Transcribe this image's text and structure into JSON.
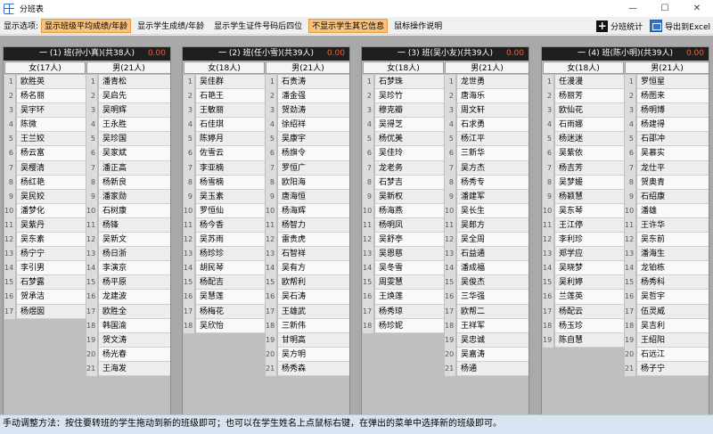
{
  "window": {
    "title": "分班表",
    "min": "—",
    "max": "☐",
    "close": "✕"
  },
  "toolbar": {
    "label": "显示选项:",
    "buttons": [
      {
        "label": "显示班级平均成绩/年龄",
        "active": true
      },
      {
        "label": "显示学生成绩/年龄",
        "active": false
      },
      {
        "label": "显示学生证件号码后四位",
        "active": false
      },
      {
        "label": "不显示学生其它信息",
        "active": true
      },
      {
        "label": "鼠标操作说明",
        "active": false
      }
    ],
    "stats_label": "分班统计",
    "export_label": "导出到Excel"
  },
  "classes": [
    {
      "header": "一 (1) 班(孙小真)(共38人)",
      "score": "0.00",
      "female_header": "女(17人)",
      "male_header": "男(21人)",
      "female": [
        "欧胜英",
        "杨名丽",
        "吴宇环",
        "陈微",
        "王兰姣",
        "杨云富",
        "吴樱清",
        "杨红艳",
        "吴民姣",
        "潘梦化",
        "吴紫丹",
        "吴东素",
        "杨宁宁",
        "李引男",
        "石梦露",
        "贺承洁",
        "杨煜囡"
      ],
      "male": [
        "潘青松",
        "吴启先",
        "吴明辉",
        "王永胜",
        "吴珍国",
        "吴家斌",
        "潘正高",
        "杨新良",
        "潘家勋",
        "石树康",
        "杨锋",
        "吴新文",
        "杨日浙",
        "李演京",
        "杨平原",
        "龙建波",
        "欧胜全",
        "韩国渝",
        "贺文涛",
        "杨光春",
        "王海发"
      ]
    },
    {
      "header": "一 (2) 班(任小雪)(共39人)",
      "score": "0.00",
      "female_header": "女(18人)",
      "male_header": "男(21人)",
      "female": [
        "吴佳群",
        "石艳王",
        "王敏丽",
        "石佳琪",
        "陈婷月",
        "佐雪云",
        "李亚楠",
        "杨雪楠",
        "吴玉素",
        "罗恒仙",
        "杨今香",
        "吴苏雨",
        "杨珍珍",
        "胡民琴",
        "杨配吉",
        "吴慧莲",
        "杨梅花",
        "吴欣怡"
      ],
      "male": [
        "石贵涛",
        "潘金强",
        "贺劲涛",
        "徐绍祥",
        "吴康宇",
        "杨旗令",
        "罗恒广",
        "欧阳海",
        "唐海恒",
        "杨海辉",
        "杨智力",
        "雷贵虎",
        "石智祥",
        "吴有方",
        "欧帮利",
        "吴石涛",
        "王雄武",
        "三新伟",
        "甘明高",
        "吴方明",
        "杨秀森"
      ]
    },
    {
      "header": "一 (3) 班(吴小友)(共39人)",
      "score": "0.00",
      "female_header": "女(18人)",
      "male_header": "男(21人)",
      "female": [
        "石梦珠",
        "吴珍竹",
        "穆克瓣",
        "吴得芝",
        "杨优美",
        "吴佳玲",
        "龙老务",
        "石梦吉",
        "吴新权",
        "杨海燕",
        "杨明凤",
        "吴舒亭",
        "吴恩慈",
        "吴冬雪",
        "周雯慧",
        "王焕莲",
        "杨秀琼",
        "杨珍妮"
      ],
      "male": [
        "龙世勇",
        "唐海乐",
        "周文轩",
        "石求勇",
        "杨江平",
        "三新华",
        "吴方杰",
        "杨秀专",
        "潘建军",
        "吴长生",
        "吴郎方",
        "吴全周",
        "石益通",
        "潘成福",
        "吴俊杰",
        "三华强",
        "欧帮二",
        "王祥军",
        "吴忠诚",
        "吴嘉涛",
        "杨通"
      ]
    },
    {
      "header": "一 (4) 班(陈小明)(共39人)",
      "score": "0.00",
      "female_header": "女(18人)",
      "male_header": "男(21人)",
      "female": [
        "任漫漫",
        "杨丽芳",
        "欧仙花",
        "石雨娜",
        "杨迷迷",
        "吴紫依",
        "杨吉芳",
        "吴梦媛",
        "杨颖慧",
        "吴东琴",
        "王江停",
        "李利珍",
        "郑学应",
        "吴晓梦",
        "吴利婷",
        "兰莲英",
        "杨配云",
        "杨玉珍",
        "陈自慧"
      ],
      "male": [
        "罗恒星",
        "杨图来",
        "杨明博",
        "杨建得",
        "石邵冲",
        "吴慕实",
        "龙仕平",
        "贺奥青",
        "石绍康",
        "潘雄",
        "王许华",
        "吴东前",
        "潘海生",
        "龙铂栋",
        "杨秀科",
        "吴哲宇",
        "伍灵威",
        "吴吉利",
        "王绍阳",
        "石远江",
        "杨子宁"
      ]
    }
  ],
  "status": "手动调整方法：按住要转班的学生拖动到新的班级即可；也可以在学生姓名上点鼠标右键，在弹出的菜单中选择新的班级即可。"
}
